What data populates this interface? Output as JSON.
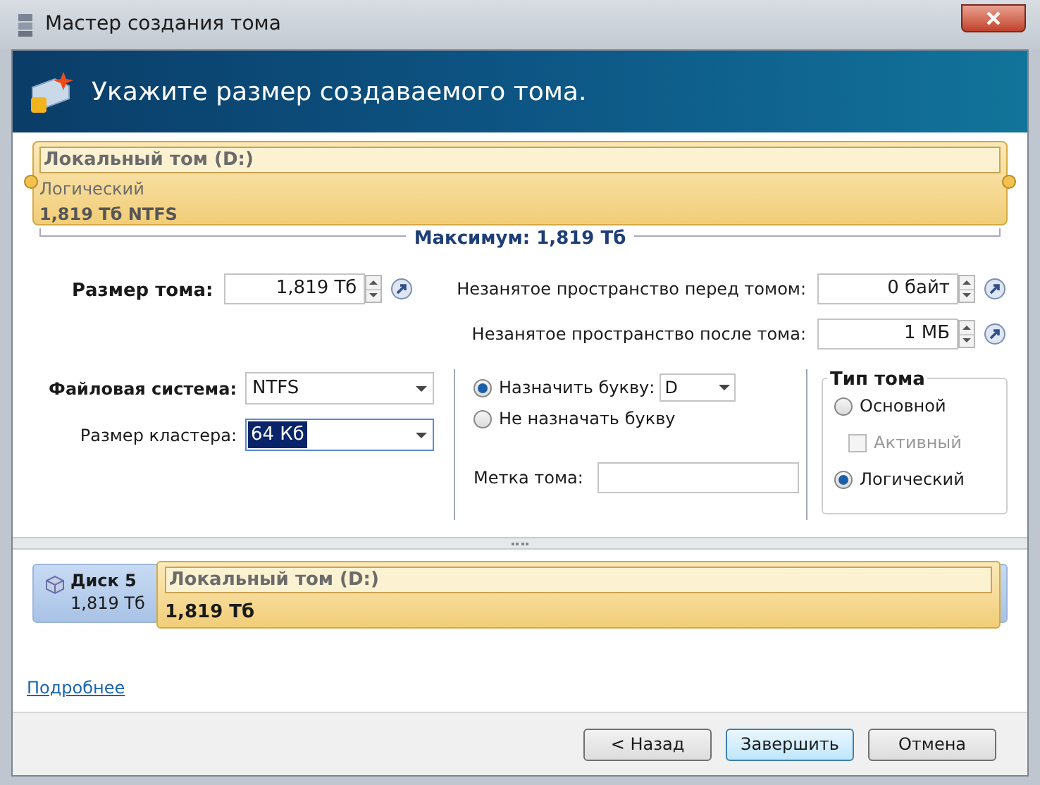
{
  "window": {
    "title": "Мастер создания тома"
  },
  "header": {
    "title": "Укажите размер создаваемого тома."
  },
  "volume_bar": {
    "name": "Локальный том (D:)",
    "type": "Логический",
    "size": "1,819 Тб NTFS",
    "maximum": "Максимум: 1,819 Тб"
  },
  "size_fields": [
    {
      "label": "Размер тома:",
      "value": "1,819 Тб"
    },
    {
      "label": "Незанятое пространство перед томом:",
      "value": "0 байт"
    },
    {
      "label": "Незанятое пространство после тома:",
      "value": "1 МБ"
    }
  ],
  "file_system": {
    "label": "Файловая система:",
    "value": "NTFS"
  },
  "cluster_size": {
    "label": "Размер кластера:",
    "value": "64 Кб"
  },
  "letter_options": [
    {
      "label": "Назначить букву:",
      "selected": true
    },
    {
      "label": "Не назначать букву",
      "selected": false
    }
  ],
  "drive_letter": "D",
  "volume_label": {
    "label": "Метка тома:"
  },
  "volume_type": {
    "title": "Тип тома",
    "options": [
      {
        "kind": "radio",
        "label": "Основной",
        "selected": false
      },
      {
        "kind": "checkbox",
        "label": "Активный",
        "checked": false,
        "disabled": true
      },
      {
        "kind": "radio",
        "label": "Логический",
        "selected": true
      }
    ]
  },
  "disk": {
    "name": "Диск 5",
    "size": "1,819 Тб",
    "volume_name": "Локальный том (D:)",
    "volume_size": "1,819 Тб"
  },
  "details_link": "Подробнее",
  "buttons": [
    {
      "label": "< Назад",
      "selected": false
    },
    {
      "label": "Завершить",
      "selected": true
    },
    {
      "label": "Отмена",
      "selected": false
    }
  ]
}
